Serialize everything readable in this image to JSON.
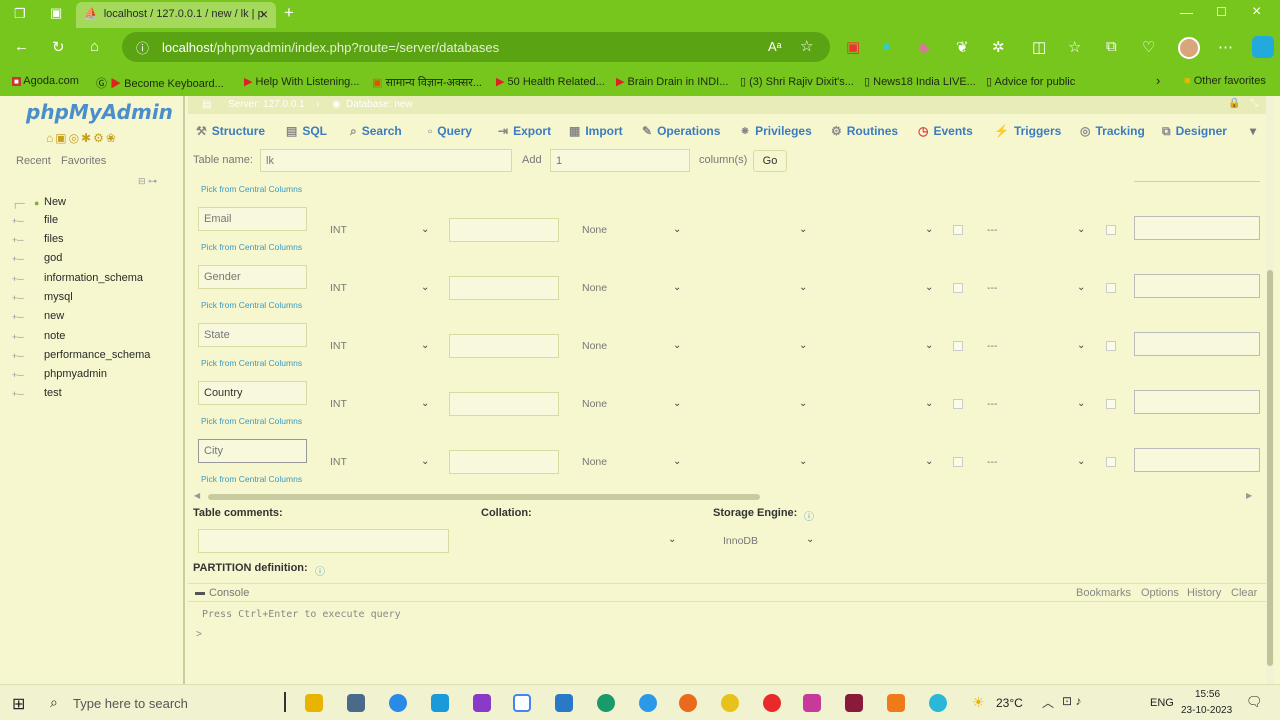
{
  "browser": {
    "tab_title": "localhost / 127.0.0.1 / new / lk | p",
    "url_host": "localhost",
    "url_path": "/phpmyadmin/index.php?route=/server/databases",
    "bookmarks": [
      "Agoda.com",
      "Become Keyboard...",
      "Help With Listening...",
      "सामान्य विज्ञान-अक्सर...",
      "50 Health Related...",
      "Brain Drain in INDI...",
      "(3) Shri Rajiv Dixit's...",
      "News18 India LIVE...",
      "Advice for public",
      "Other favorites"
    ]
  },
  "pma": {
    "logo": "phpMyAdmin",
    "recent": "Recent",
    "favorites": "Favorites",
    "databases": [
      "New",
      "file",
      "files",
      "god",
      "information_schema",
      "mysql",
      "new",
      "note",
      "performance_schema",
      "phpmyadmin",
      "test"
    ],
    "breadcrumb_server": "Server: 127.0.0.1",
    "breadcrumb_db": "Database: new",
    "tabs": [
      "Structure",
      "SQL",
      "Search",
      "Query",
      "Export",
      "Import",
      "Operations",
      "Privileges",
      "Routines",
      "Events",
      "Triggers",
      "Tracking",
      "Designer"
    ],
    "table_name_label": "Table name:",
    "table_name_value": "lk",
    "add_label": "Add",
    "add_value": "1",
    "columns_label": "column(s)",
    "go": "Go",
    "pick_label": "Pick from Central Columns",
    "columns": [
      {
        "name": "Email",
        "type": "INT",
        "default": "None",
        "attr": "---"
      },
      {
        "name": "Gender",
        "type": "INT",
        "default": "None",
        "attr": "---"
      },
      {
        "name": "State",
        "type": "INT",
        "default": "None",
        "attr": "---"
      },
      {
        "name": "Country",
        "type": "INT",
        "default": "None",
        "attr": "---"
      },
      {
        "name": "City",
        "type": "INT",
        "default": "None",
        "attr": "---"
      }
    ],
    "table_comments": "Table comments:",
    "collation": "Collation:",
    "storage_engine": "Storage Engine:",
    "engine_value": "InnoDB",
    "partition": "PARTITION definition:",
    "console": "Console",
    "console_links": [
      "Bookmarks",
      "Options",
      "History",
      "Clear"
    ],
    "console_hint": "Press Ctrl+Enter to execute query",
    "console_prompt": ">"
  },
  "taskbar": {
    "search": "Type here to search",
    "temp": "23°C",
    "lang": "ENG",
    "time": "15:56",
    "date": "23-10-2023"
  }
}
